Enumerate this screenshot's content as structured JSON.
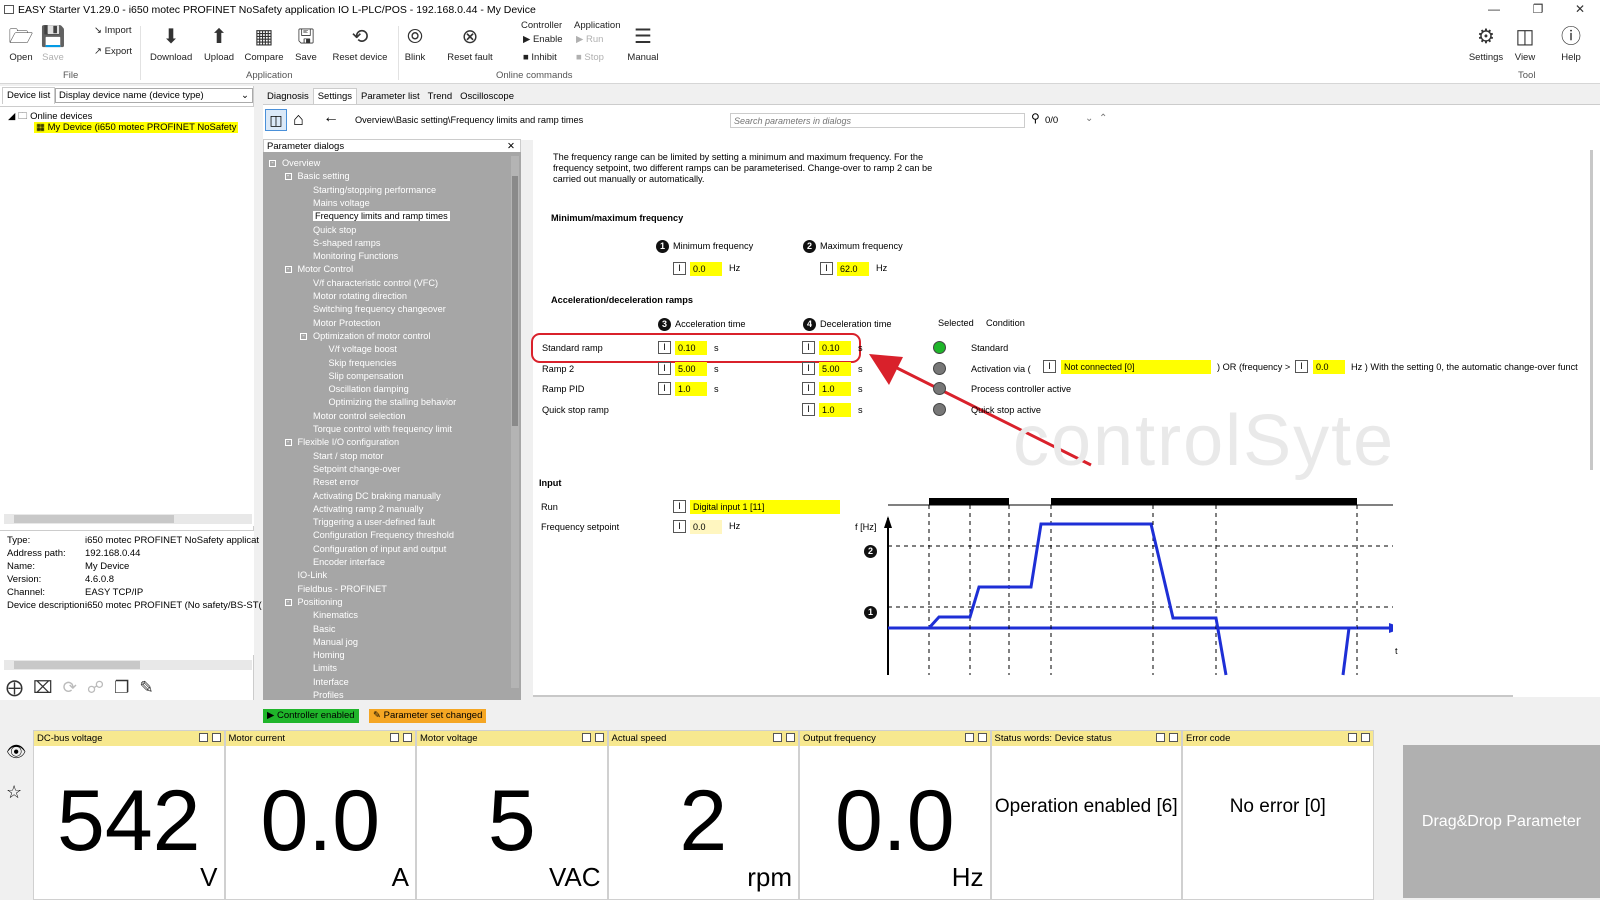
{
  "window": {
    "title": "EASY Starter V1.29.0 - i650 motec PROFINET NoSafety application IO L-PLC/POS - 192.168.0.44 - My Device"
  },
  "ribbon": {
    "file": {
      "open": "Open",
      "save": "Save",
      "import": "Import",
      "export": "Export",
      "group": "File"
    },
    "application": {
      "download": "Download",
      "upload": "Upload",
      "compare": "Compare",
      "save": "Save",
      "reset_device": "Reset device",
      "group": "Application"
    },
    "online": {
      "blink": "Blink",
      "reset_fault": "Reset fault",
      "controller": "Controller",
      "enable": "Enable",
      "inhibit": "Inhibit",
      "application": "Application",
      "run": "Run",
      "stop": "Stop",
      "manual": "Manual",
      "group": "Online commands"
    },
    "tool": {
      "settings": "Settings",
      "view": "View",
      "help": "Help",
      "group": "Tool"
    }
  },
  "left": {
    "tab": "Device list",
    "dropdown": "Display device name (device type)",
    "tree_root": "Online devices",
    "device": "My Device (i650 motec PROFINET NoSafety",
    "props": [
      {
        "k": "Type:",
        "v": "i650 motec PROFINET NoSafety applicat"
      },
      {
        "k": "Address path:",
        "v": "192.168.0.44"
      },
      {
        "k": "Name:",
        "v": "My Device"
      },
      {
        "k": "Version:",
        "v": "4.6.0.8"
      },
      {
        "k": "Channel:",
        "v": "EASY TCP/IP"
      },
      {
        "k": "Device description:",
        "v": "i650 motec PROFINET (No safety/BS-ST("
      }
    ]
  },
  "tabs": [
    "Diagnosis",
    "Settings",
    "Parameter list",
    "Trend",
    "Oscilloscope"
  ],
  "nav": {
    "breadcrumb": "Overview\\Basic setting\\Frequency limits and ramp times",
    "search_placeholder": "Search parameters in dialogs",
    "result": "0/0"
  },
  "tree": {
    "title": "Parameter dialogs",
    "items": [
      "Overview",
      "Basic setting",
      "Starting/stopping performance",
      "Mains voltage",
      "Frequency limits and ramp times",
      "Quick stop",
      "S-shaped ramps",
      "Monitoring Functions",
      "Motor Control",
      "V/f characteristic control (VFC)",
      "Motor rotating direction",
      "Switching frequency changeover",
      "Motor Protection",
      "Optimization of motor control",
      "V/f voltage boost",
      "Skip frequencies",
      "Slip compensation",
      "Oscillation damping",
      "Optimizing the stalling behavior",
      "Motor control selection",
      "Torque control with frequency limit",
      "Flexible I/O configuration",
      "Start / stop motor",
      "Setpoint change-over",
      "Reset error",
      "Activating DC braking manually",
      "Activating ramp 2 manually",
      "Triggering a user-defined fault",
      "Configuration Frequency threshold",
      "Configuration of input and output",
      "Encoder interface",
      "IO-Link",
      "Fieldbus - PROFINET",
      "Positioning",
      "Kinematics",
      "Basic",
      "Manual jog",
      "Homing",
      "Limits",
      "Interface",
      "Profiles"
    ]
  },
  "content": {
    "desc1": "The frequency range can be limited by setting a minimum and maximum frequency. For the",
    "desc2": "frequency setpoint, two different ramps can be parameterised. Change-over to ramp 2 can be",
    "desc3": "carried out manually or automatically.",
    "minmax_title": "Minimum/maximum frequency",
    "min_label": "Minimum frequency",
    "max_label": "Maximum frequency",
    "min_value": "0.0",
    "max_value": "62.0",
    "hz": "Hz",
    "s": "s",
    "ramps_title": "Acceleration/deceleration ramps",
    "acc_label": "Acceleration time",
    "dec_label": "Deceleration time",
    "selected_label": "Selected",
    "condition_label": "Condition",
    "ramps": [
      {
        "name": "Standard ramp",
        "acc": "0.10",
        "dec": "0.10",
        "condition": "Standard",
        "active": true
      },
      {
        "name": "Ramp 2",
        "acc": "5.00",
        "dec": "5.00",
        "condition": "Activation via (",
        "active": false
      },
      {
        "name": "Ramp PID",
        "acc": "1.0",
        "dec": "1.0",
        "condition": "Process controller active",
        "active": false
      },
      {
        "name": "Quick stop ramp",
        "acc": "",
        "dec": "1.0",
        "condition": "Quick stop active",
        "active": false
      }
    ],
    "not_connected": "Not connected [0]",
    "or_freq": ") OR  (frequency >",
    "freq_thr": "0.0",
    "hz_note": "Hz ) With the setting 0, the automatic change-over funct",
    "input_title": "Input",
    "run_label": "Run",
    "run_value": "Digital input 1 [11]",
    "fset_label": "Frequency setpoint",
    "fset_value": "0.0",
    "graph_y": "f [Hz]",
    "graph_x": "t",
    "m1": "1",
    "m2": "2",
    "watermark": "controlSyte"
  },
  "badges": {
    "controller": "Controller enabled",
    "param": "Parameter set changed"
  },
  "colors": {
    "highlight": "#ffff00",
    "tile_header": "#f7e88f",
    "green": "#1fb52a",
    "orange": "#f5a623",
    "red_callout": "#d9212b",
    "graph_blue": "#1e2fd6"
  },
  "tiles": [
    {
      "title": "DC-bus voltage",
      "value": "542",
      "unit": "V"
    },
    {
      "title": "Motor current",
      "value": "0.0",
      "unit": "A"
    },
    {
      "title": "Motor voltage",
      "value": "5",
      "unit": "VAC"
    },
    {
      "title": "Actual speed",
      "value": "2",
      "unit": "rpm"
    },
    {
      "title": "Output frequency",
      "value": "0.0",
      "unit": "Hz"
    },
    {
      "title": "Status words: Device status",
      "text": "Operation enabled [6]"
    },
    {
      "title": "Error code",
      "text": "No error [0]"
    }
  ],
  "drag_drop": "Drag&Drop Parameter"
}
